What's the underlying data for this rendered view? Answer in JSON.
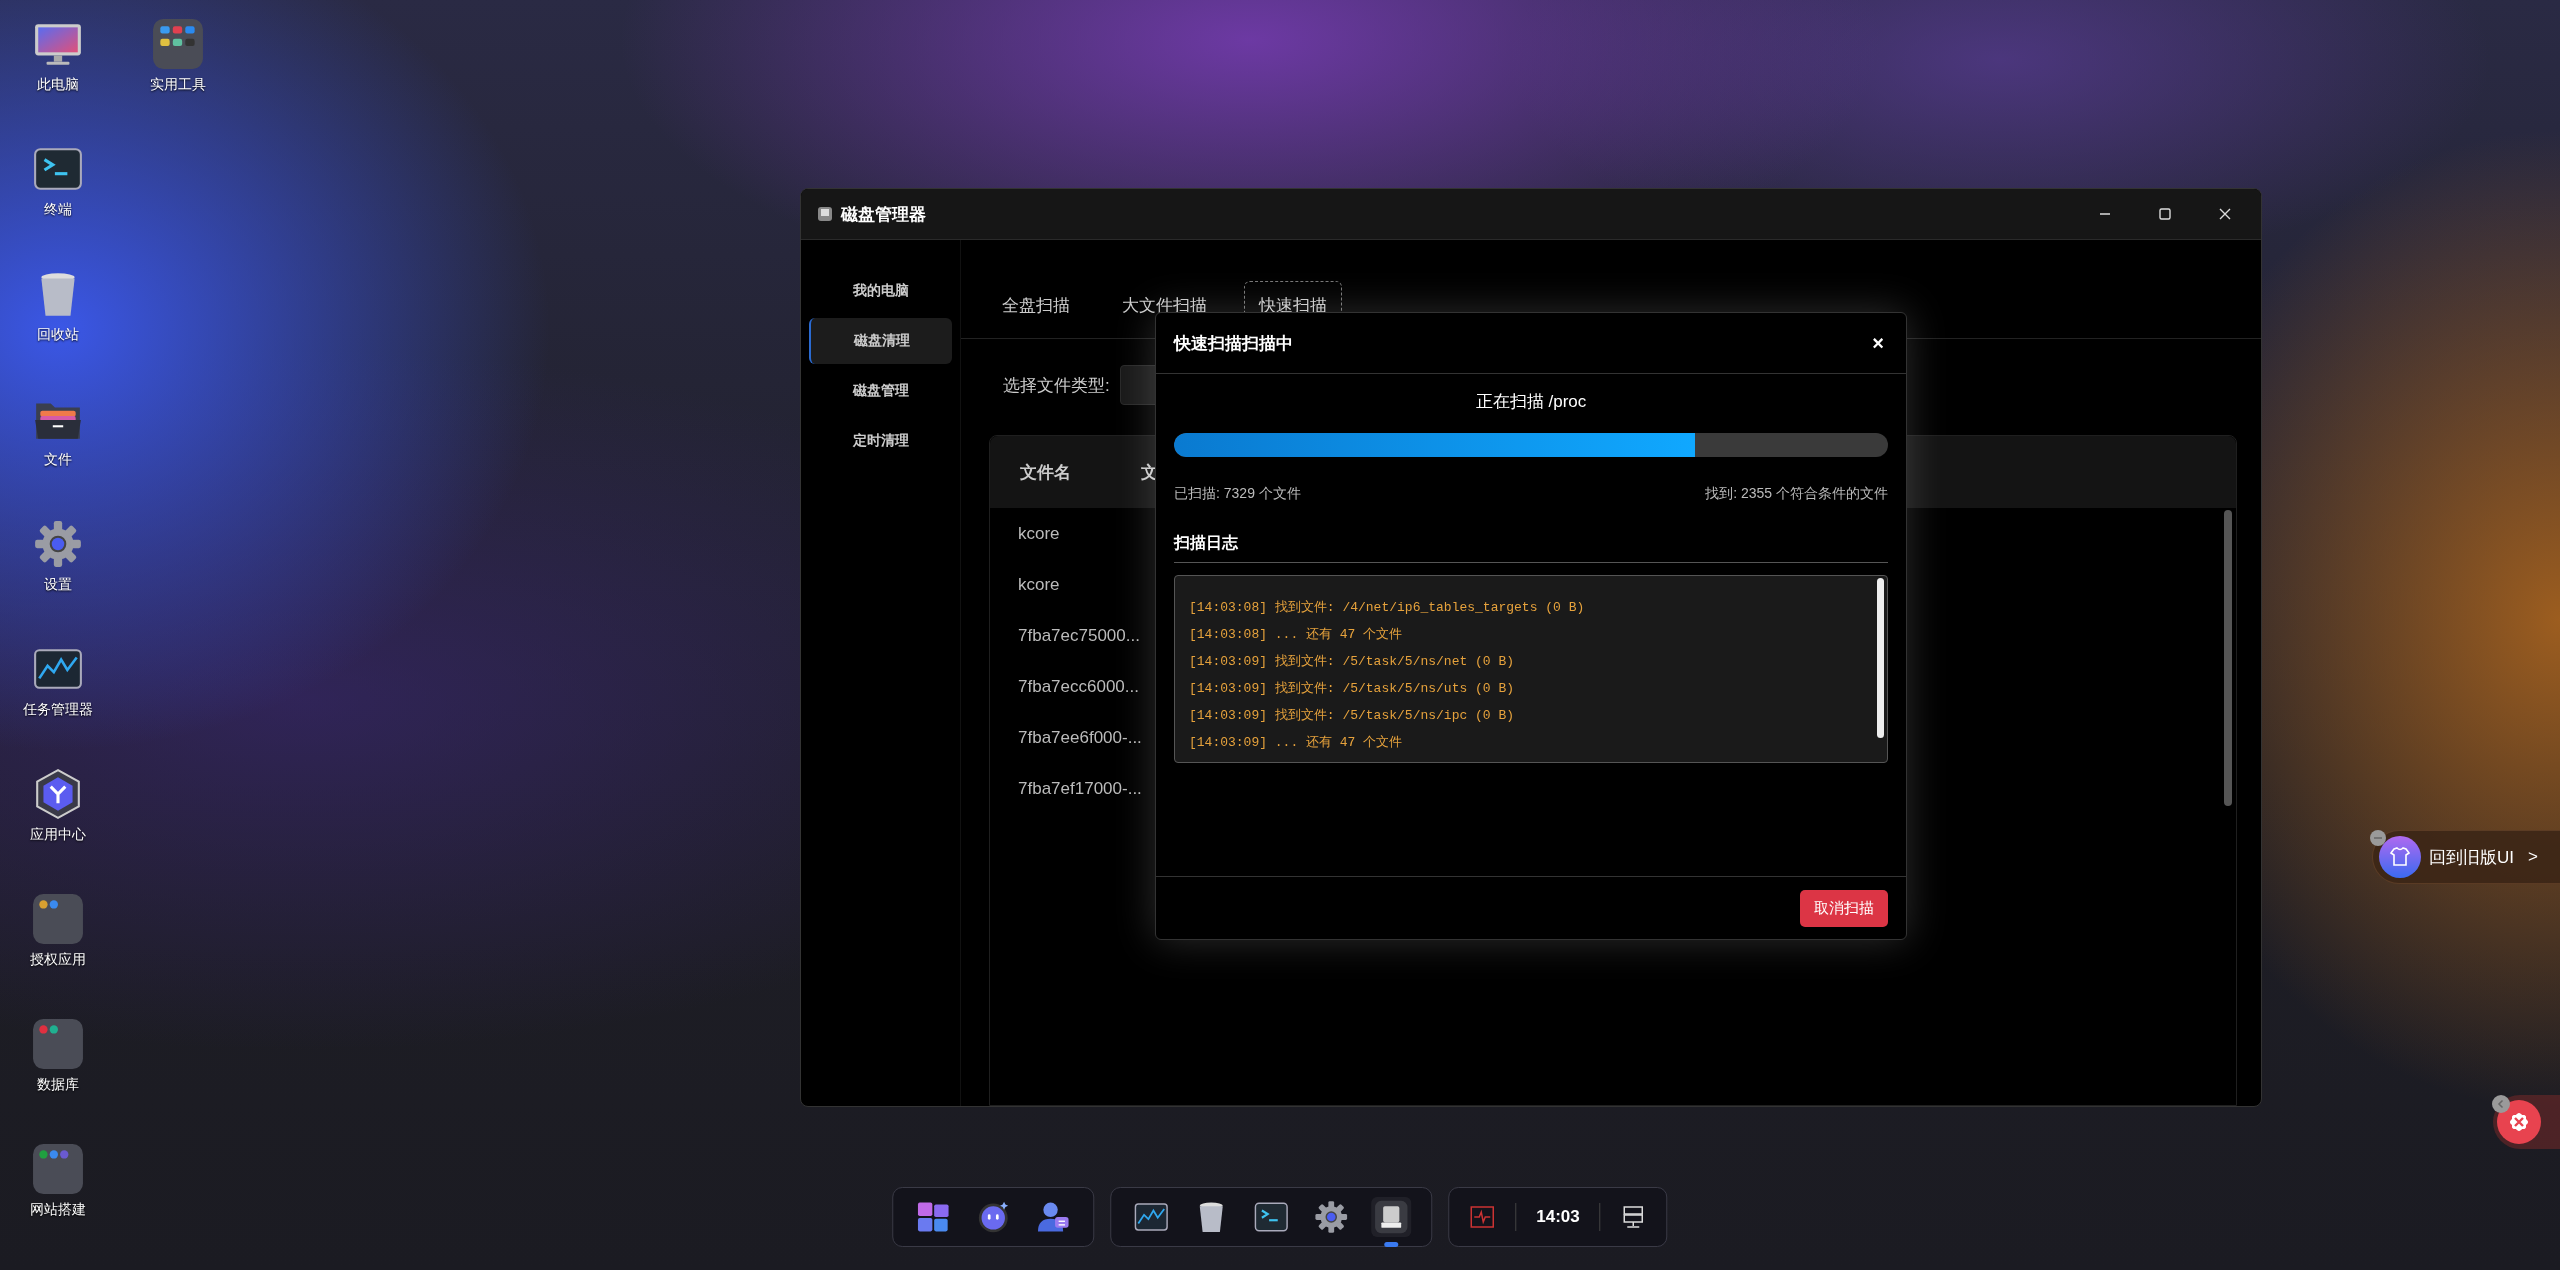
{
  "desktop_icons": [
    {
      "label": "此电脑",
      "kind": "computer"
    },
    {
      "label": "终端",
      "kind": "terminal"
    },
    {
      "label": "回收站",
      "kind": "trash"
    },
    {
      "label": "文件",
      "kind": "folder"
    },
    {
      "label": "设置",
      "kind": "gear"
    },
    {
      "label": "任务管理器",
      "kind": "chart"
    },
    {
      "label": "应用中心",
      "kind": "hexagon"
    },
    {
      "label": "授权应用",
      "kind": "tile-license"
    },
    {
      "label": "数据库",
      "kind": "tile-database"
    },
    {
      "label": "网站搭建",
      "kind": "tile-web"
    },
    {
      "label": "实用工具",
      "kind": "tile-tools"
    }
  ],
  "window": {
    "title": "磁盘管理器",
    "sidebar": {
      "items": [
        {
          "label": "我的电脑",
          "selected": false
        },
        {
          "label": "磁盘清理",
          "selected": true
        },
        {
          "label": "磁盘管理",
          "selected": false
        },
        {
          "label": "定时清理",
          "selected": false
        }
      ]
    },
    "tabs": [
      {
        "label": "全盘扫描",
        "selected": false
      },
      {
        "label": "大文件扫描",
        "selected": false
      },
      {
        "label": "快速扫描",
        "selected": true
      }
    ],
    "filter_label": "选择文件类型:",
    "table": {
      "columns": [
        "文件名",
        "文"
      ],
      "rows": [
        "kcore",
        "kcore",
        "7fba7ec75000...",
        "7fba7ecc6000...",
        "7fba7ee6f000-...",
        "7fba7ef17000-..."
      ]
    }
  },
  "dialog": {
    "title": "快速扫描扫描中",
    "close": "×",
    "status": "正在扫描 /proc",
    "progress": {
      "level": 0.73
    },
    "scanned": "已扫描: 7329 个文件",
    "found": "找到: 2355 个符合条件的文件",
    "log_title": "扫描日志",
    "log": [
      "[14:03:08] 找到文件: /4/net/ip6_tables_targets (0 B)",
      "[14:03:08] ... 还有 47 个文件",
      "[14:03:09] 找到文件: /5/task/5/ns/net (0 B)",
      "[14:03:09] 找到文件: /5/task/5/ns/uts (0 B)",
      "[14:03:09] 找到文件: /5/task/5/ns/ipc (0 B)",
      "[14:03:09] ... 还有 47 个文件"
    ],
    "cancel": "取消扫描"
  },
  "taskbar": {
    "groups": [
      [
        {
          "kind": "tiles",
          "active": false
        },
        {
          "kind": "bot",
          "active": false
        },
        {
          "kind": "user",
          "active": false
        }
      ],
      [
        {
          "kind": "chart",
          "active": false
        },
        {
          "kind": "trash",
          "active": false
        },
        {
          "kind": "terminal",
          "active": false
        },
        {
          "kind": "gear",
          "active": false
        },
        {
          "kind": "disk",
          "active": true
        }
      ]
    ],
    "clock": "14:03"
  },
  "old_ui": {
    "label": "回到旧版UI",
    "arrow": ">"
  }
}
